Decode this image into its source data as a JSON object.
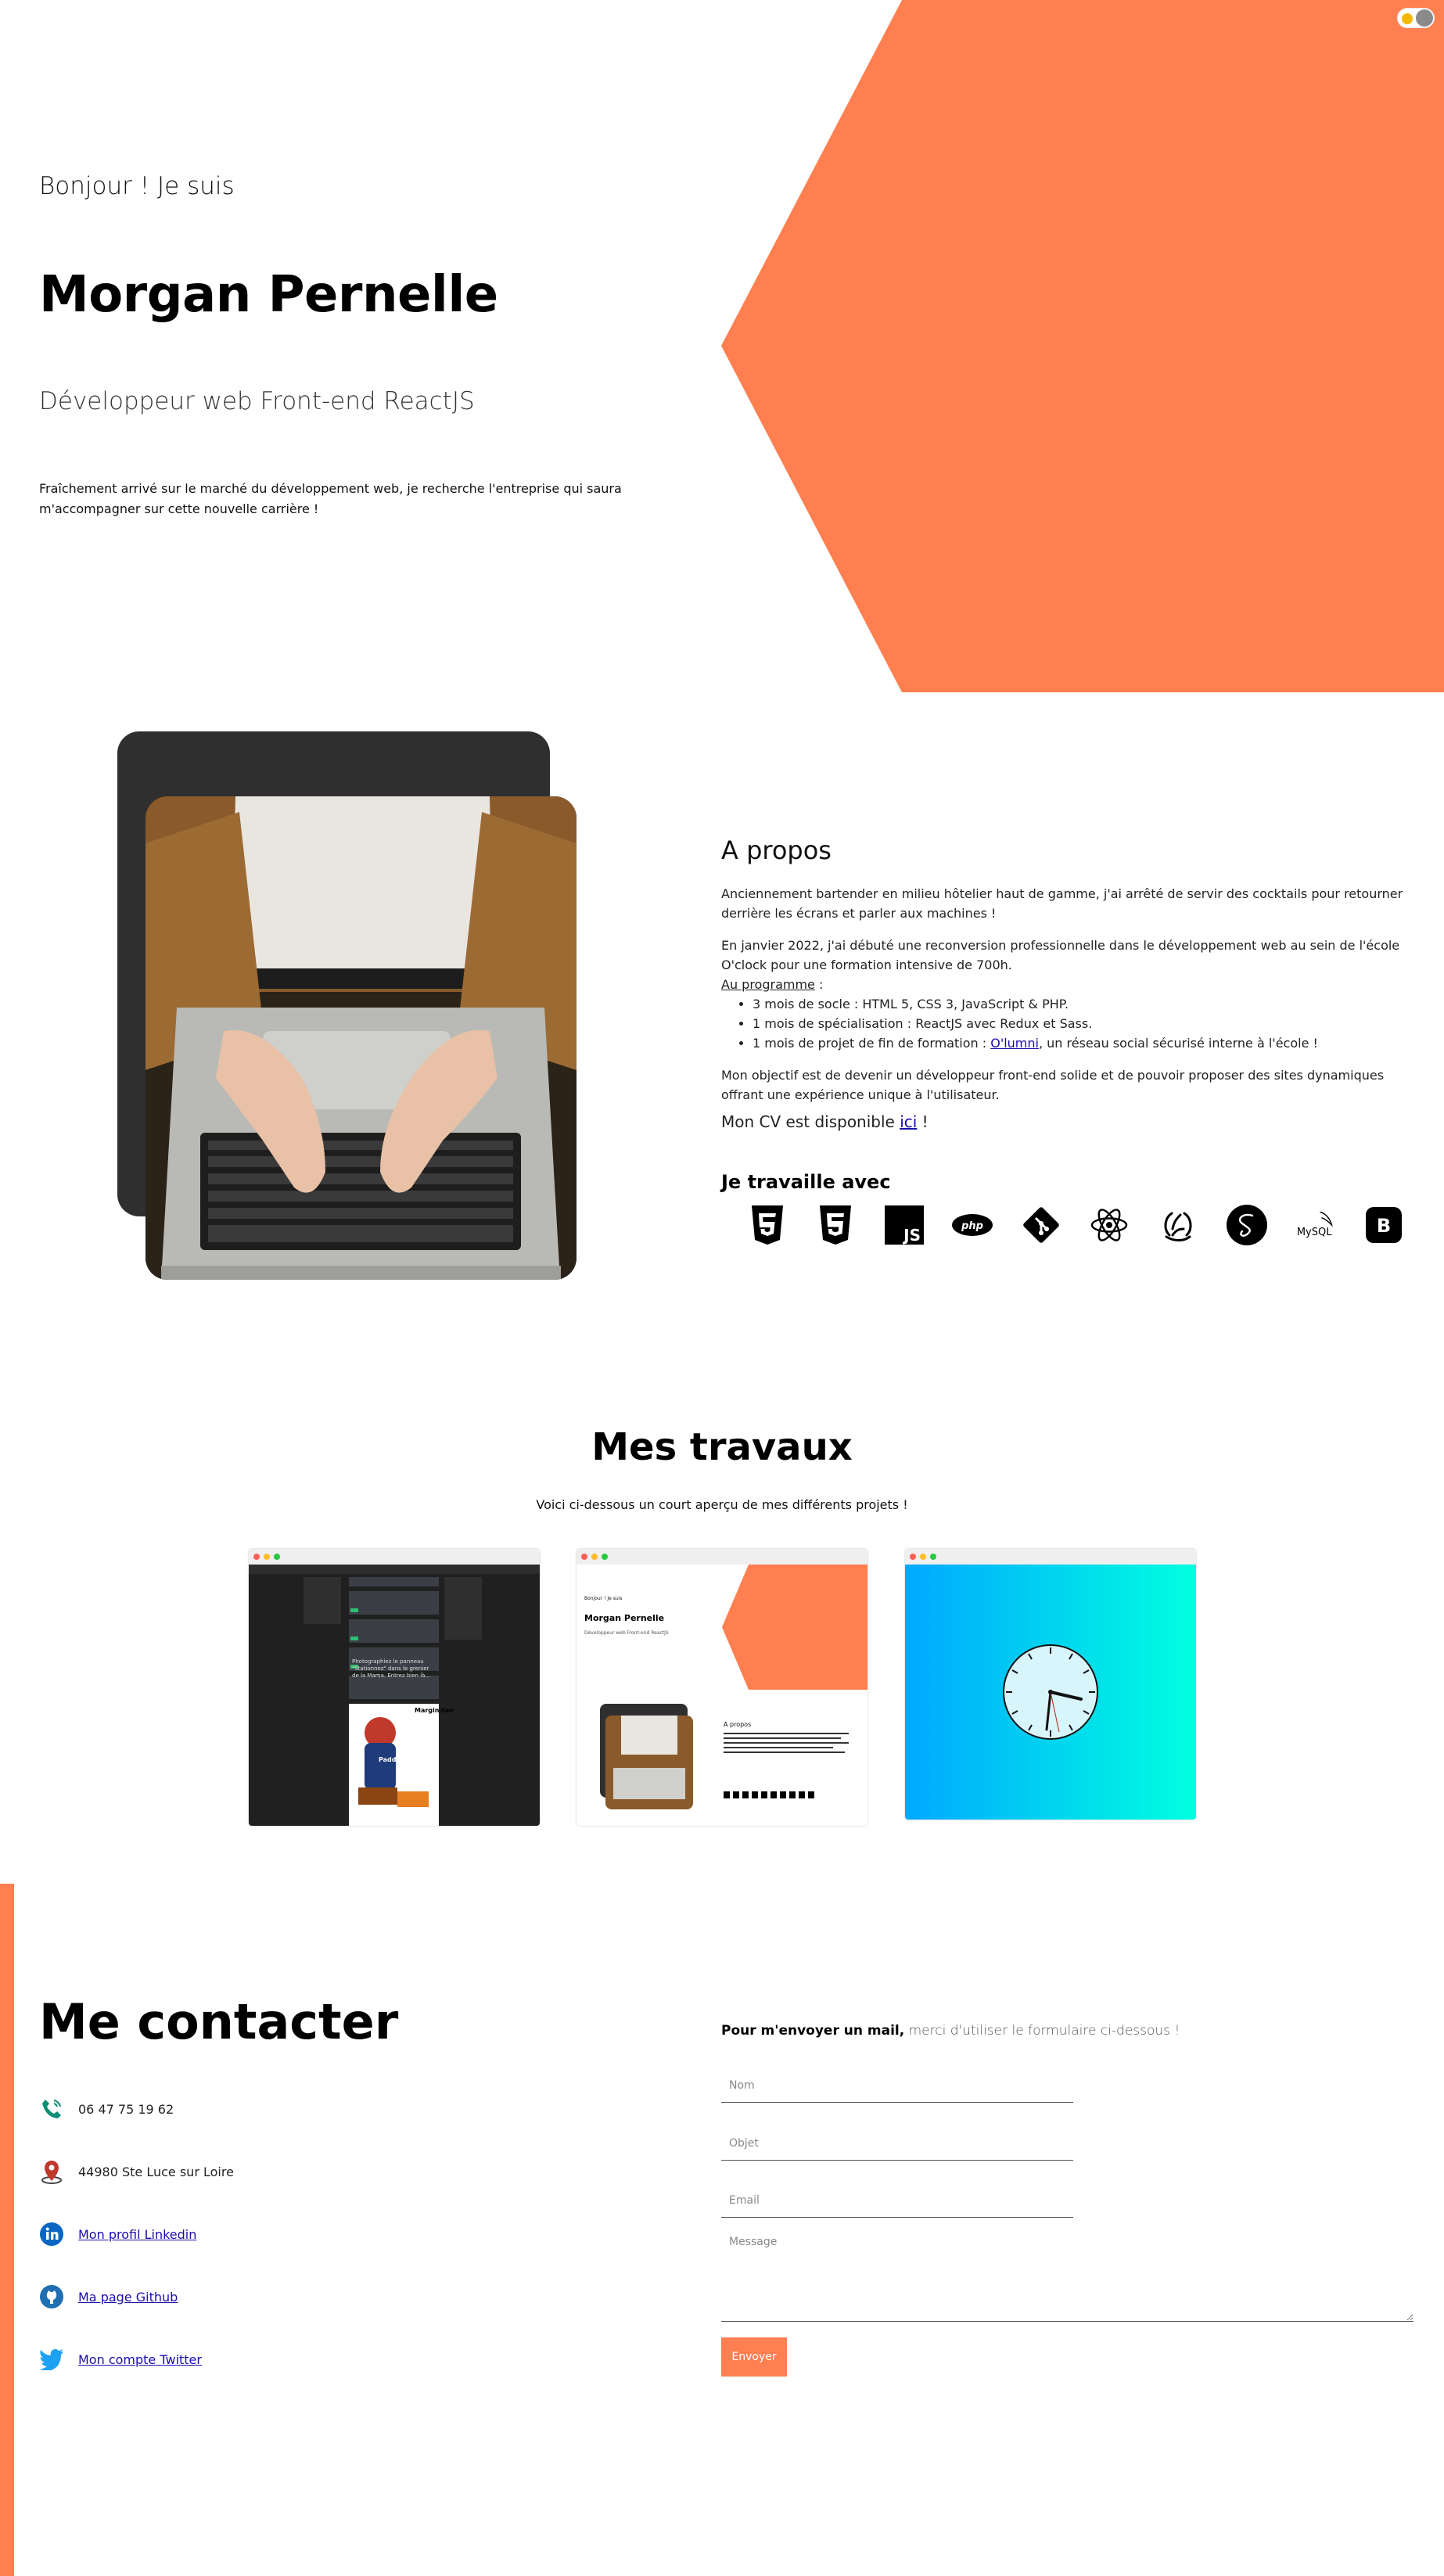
{
  "colors": {
    "accent": "#ff7f50",
    "dark_card": "#2f2f2f",
    "link": "#1a0dab"
  },
  "hero": {
    "greeting": "Bonjour ! Je suis",
    "name": "Morgan Pernelle",
    "job": "Développeur web Front-end ReactJS",
    "intro": "Fraîchement arrivé sur le marché du développement web, je recherche l'entreprise qui saura m'accompagner sur cette nouvelle carrière !"
  },
  "theme_toggle": {
    "icon": "sun-icon"
  },
  "about": {
    "title": "A propos",
    "p1": "Anciennement bartender en milieu hôtelier haut de gamme, j'ai arrêté de servir des cocktails pour retourner derrière les écrans et parler aux machines !",
    "p2": "En janvier 2022, j'ai débuté une reconversion professionnelle dans le développement web au sein de l'école O'clock pour une formation intensive de 700h.",
    "program_label": "Au programme",
    "program_suffix": " :",
    "li1": "3 mois de socle : HTML 5, CSS 3, JavaScript & PHP.",
    "li2": "1 mois de spécialisation : ReactJS avec Redux et Sass.",
    "li3_prefix": "1 mois de projet de fin de formation : ",
    "li3_link": "O'lumni",
    "li3_suffix": ", un réseau social sécurisé interne à l'école !",
    "p3": "Mon objectif est de devenir un développeur front-end solide et de pouvoir proposer des sites dynamiques offrant une expérience unique à l'utilisateur.",
    "cv_prefix": "Mon CV est disponible ",
    "cv_link": "ici",
    "cv_suffix": " !",
    "work_title": "Je travaille avec",
    "skills": [
      "html5-icon",
      "css3-icon",
      "javascript-icon",
      "php-icon",
      "git-icon",
      "react-icon",
      "redux-icon",
      "sass-icon",
      "mysql-icon",
      "bootstrap-icon"
    ],
    "skill_labels": {
      "js": "JS",
      "php": "php",
      "mysql": "MySQL",
      "bootstrap": "B"
    }
  },
  "projects": {
    "title": "Mes travaux",
    "subtitle": "Voici ci-dessous un court aperçu de mes différents projets !",
    "olumni_caption": "Margin-tan",
    "olumni_caption2": "Padding-ton",
    "olumni_post": "Photographiez le panneau \"Stationnez\" dans le grenier de la Mama. Entrez bien là...",
    "portfolio_greeting": "Bonjour ! Je suis",
    "portfolio_name": "Morgan Pernelle",
    "portfolio_job": "Développeur web Front-end ReactJS",
    "portfolio_about": "A propos"
  },
  "contact": {
    "title": "Me contacter",
    "phone": "06 47 75 19 62",
    "address": "44980 Ste Luce sur Loire",
    "linkedin": "Mon profil Linkedin",
    "github": "Ma page Github",
    "twitter": "Mon compte Twitter",
    "form_intro_bold": "Pour m'envoyer un mail,",
    "form_intro_rest": " merci d'utiliser le formulaire ci-dessous !",
    "placeholder_name": "Nom",
    "placeholder_subject": "Objet",
    "placeholder_email": "Email",
    "placeholder_message": "Message",
    "send": "Envoyer"
  }
}
